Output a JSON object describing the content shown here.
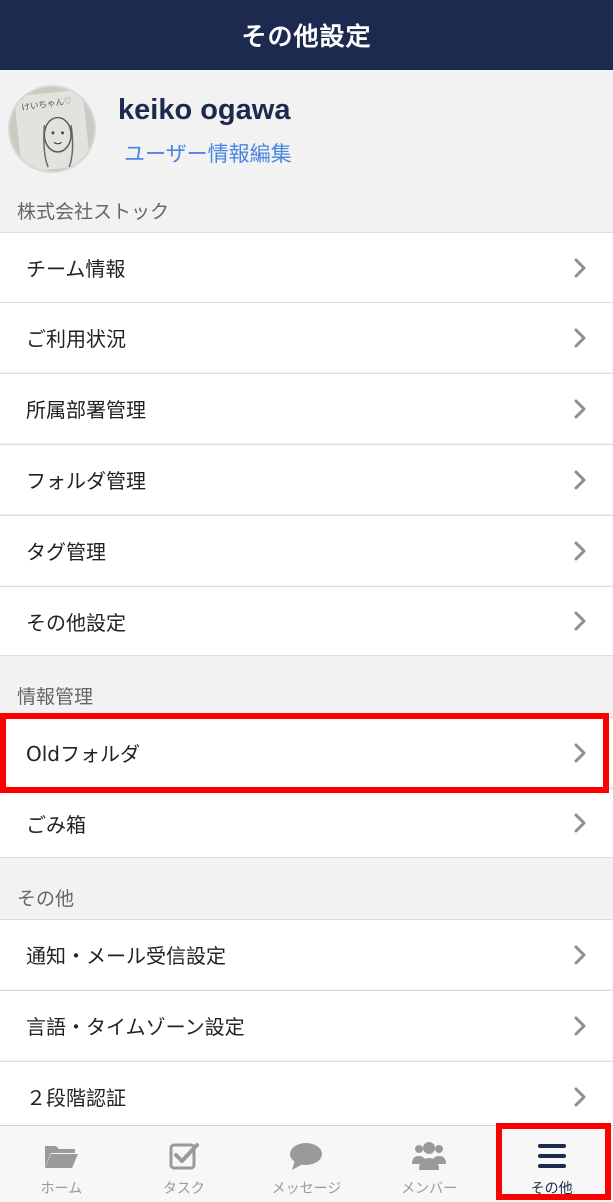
{
  "header": {
    "title": "その他設定"
  },
  "profile": {
    "name": "keiko ogawa",
    "edit_label": "ユーザー情報編集",
    "avatar_text": "けいちゃん♡"
  },
  "sections": {
    "company": {
      "title": "株式会社ストック",
      "items": [
        "チーム情報",
        "ご利用状況",
        "所属部署管理",
        "フォルダ管理",
        "タグ管理",
        "その他設定"
      ]
    },
    "info": {
      "title": "情報管理",
      "items": [
        "Oldフォルダ",
        "ごみ箱"
      ]
    },
    "other": {
      "title": "その他",
      "items": [
        "通知・メール受信設定",
        "言語・タイムゾーン設定",
        "２段階認証"
      ]
    }
  },
  "tabbar": {
    "tabs": [
      {
        "label": "ホーム",
        "icon": "folder-icon"
      },
      {
        "label": "タスク",
        "icon": "task-check-icon"
      },
      {
        "label": "メッセージ",
        "icon": "chat-bubble-icon"
      },
      {
        "label": "メンバー",
        "icon": "members-icon"
      },
      {
        "label": "その他",
        "icon": "menu-icon"
      }
    ],
    "active_index": 4
  },
  "colors": {
    "header_bg": "#1d2a4f",
    "accent_link": "#4a86e0",
    "highlight": "#ff0000",
    "tab_inactive": "#9a9a9a",
    "tab_active": "#1d2a4f"
  }
}
